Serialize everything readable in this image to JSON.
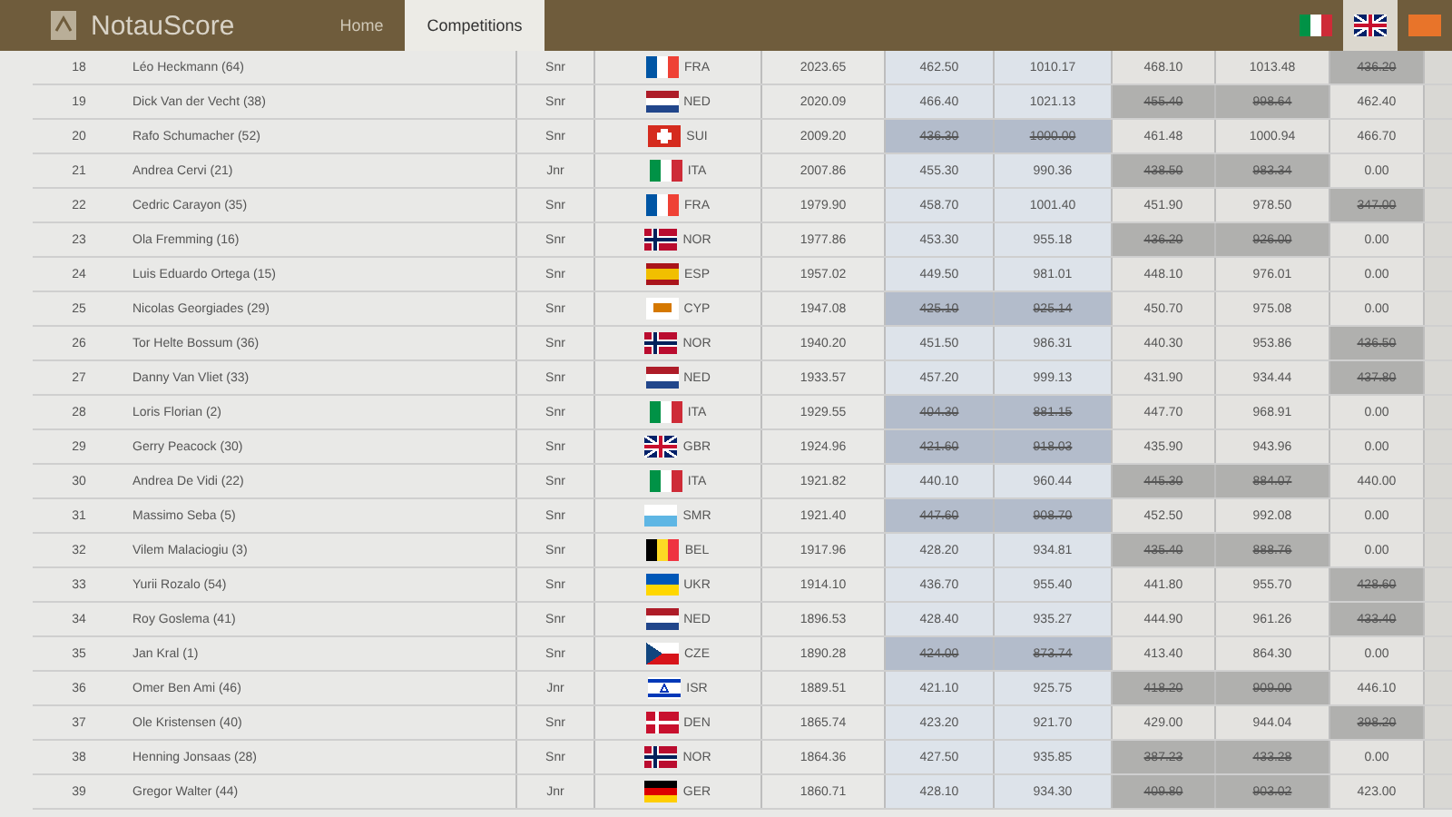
{
  "navbar": {
    "brand": "NotauScore",
    "tabs": [
      {
        "label": "Home",
        "selected": false
      },
      {
        "label": "Competitions",
        "selected": true
      }
    ],
    "languages": [
      {
        "flag": {
          "kind": "v3",
          "stripes": [
            {
              "color": "#009246"
            },
            {
              "color": "#ffffff"
            },
            {
              "color": "#ce2b37"
            }
          ]
        },
        "selected": false
      },
      {
        "flag": {
          "kind": "union",
          "stripes": [
            {
              "color": "#012169"
            },
            {
              "color": "#ffffff"
            },
            {
              "color": "#c8102e"
            }
          ]
        },
        "selected": true
      },
      {
        "flag": {
          "kind": "v3",
          "stripes": [
            {
              "color": "#e8742a"
            },
            {
              "color": "#e8742a"
            },
            {
              "color": "#e8742a"
            }
          ]
        },
        "selected": false
      }
    ]
  },
  "rows": [
    {
      "rank": "18",
      "name": "Léo Heckmann (64)",
      "category": "Snr",
      "nation": "FRA",
      "flag": {
        "kind": "v3",
        "stripes": [
          {
            "color": "#0055a4"
          },
          {
            "color": "#ffffff"
          },
          {
            "color": "#ef4135"
          }
        ]
      },
      "total": "2023.65",
      "scores": [
        {
          "value": "462.50",
          "dropped": false
        },
        {
          "value": "1010.17",
          "dropped": false
        },
        {
          "value": "468.10",
          "dropped": false
        },
        {
          "value": "1013.48",
          "dropped": false
        },
        {
          "value": "436.20",
          "dropped": true
        }
      ]
    },
    {
      "rank": "19",
      "name": "Dick Van der Vecht (38)",
      "category": "Snr",
      "nation": "NED",
      "flag": {
        "kind": "h3",
        "stripes": [
          {
            "color": "#ae1c28"
          },
          {
            "color": "#ffffff"
          },
          {
            "color": "#21468b"
          }
        ]
      },
      "total": "2020.09",
      "scores": [
        {
          "value": "466.40",
          "dropped": false
        },
        {
          "value": "1021.13",
          "dropped": false
        },
        {
          "value": "455.40",
          "dropped": true
        },
        {
          "value": "998.64",
          "dropped": true
        },
        {
          "value": "462.40",
          "dropped": false
        }
      ]
    },
    {
      "rank": "20",
      "name": "Rafo Schumacher (52)",
      "category": "Snr",
      "nation": "SUI",
      "flag": {
        "kind": "swiss",
        "stripes": [
          {
            "color": "#d52b1e"
          },
          {
            "color": "#ffffff"
          }
        ]
      },
      "total": "2009.20",
      "scores": [
        {
          "value": "436.30",
          "dropped": true
        },
        {
          "value": "1000.00",
          "dropped": true
        },
        {
          "value": "461.48",
          "dropped": false
        },
        {
          "value": "1000.94",
          "dropped": false
        },
        {
          "value": "466.70",
          "dropped": false
        }
      ]
    },
    {
      "rank": "21",
      "name": "Andrea Cervi (21)",
      "category": "Jnr",
      "nation": "ITA",
      "flag": {
        "kind": "v3",
        "stripes": [
          {
            "color": "#009246"
          },
          {
            "color": "#ffffff"
          },
          {
            "color": "#ce2b37"
          }
        ]
      },
      "total": "2007.86",
      "scores": [
        {
          "value": "455.30",
          "dropped": false
        },
        {
          "value": "990.36",
          "dropped": false
        },
        {
          "value": "438.50",
          "dropped": true
        },
        {
          "value": "983.34",
          "dropped": true
        },
        {
          "value": "0.00",
          "dropped": false
        }
      ]
    },
    {
      "rank": "22",
      "name": "Cedric Carayon (35)",
      "category": "Snr",
      "nation": "FRA",
      "flag": {
        "kind": "v3",
        "stripes": [
          {
            "color": "#0055a4"
          },
          {
            "color": "#ffffff"
          },
          {
            "color": "#ef4135"
          }
        ]
      },
      "total": "1979.90",
      "scores": [
        {
          "value": "458.70",
          "dropped": false
        },
        {
          "value": "1001.40",
          "dropped": false
        },
        {
          "value": "451.90",
          "dropped": false
        },
        {
          "value": "978.50",
          "dropped": false
        },
        {
          "value": "347.00",
          "dropped": true
        }
      ]
    },
    {
      "rank": "23",
      "name": "Ola Fremming (16)",
      "category": "Snr",
      "nation": "NOR",
      "flag": {
        "kind": "nordic2",
        "stripes": [
          {
            "color": "#ba0c2f"
          },
          {
            "color": "#ffffff"
          },
          {
            "color": "#00205b"
          }
        ]
      },
      "total": "1977.86",
      "scores": [
        {
          "value": "453.30",
          "dropped": false
        },
        {
          "value": "955.18",
          "dropped": false
        },
        {
          "value": "436.20",
          "dropped": true
        },
        {
          "value": "926.00",
          "dropped": true
        },
        {
          "value": "0.00",
          "dropped": false
        }
      ]
    },
    {
      "rank": "24",
      "name": "Luis Eduardo Ortega (15)",
      "category": "Snr",
      "nation": "ESP",
      "flag": {
        "kind": "spain",
        "stripes": [
          {
            "color": "#aa151b"
          },
          {
            "color": "#f1bf00"
          }
        ]
      },
      "total": "1957.02",
      "scores": [
        {
          "value": "449.50",
          "dropped": false
        },
        {
          "value": "981.01",
          "dropped": false
        },
        {
          "value": "448.10",
          "dropped": false
        },
        {
          "value": "976.01",
          "dropped": false
        },
        {
          "value": "0.00",
          "dropped": false
        }
      ]
    },
    {
      "rank": "25",
      "name": "Nicolas Georgiades (29)",
      "category": "Snr",
      "nation": "CYP",
      "flag": {
        "kind": "cyprus",
        "stripes": [
          {
            "color": "#ffffff"
          },
          {
            "color": "#d57800"
          }
        ]
      },
      "total": "1947.08",
      "scores": [
        {
          "value": "425.10",
          "dropped": true
        },
        {
          "value": "925.14",
          "dropped": true
        },
        {
          "value": "450.70",
          "dropped": false
        },
        {
          "value": "975.08",
          "dropped": false
        },
        {
          "value": "0.00",
          "dropped": false
        }
      ]
    },
    {
      "rank": "26",
      "name": "Tor Helte Bossum (36)",
      "category": "Snr",
      "nation": "NOR",
      "flag": {
        "kind": "nordic2",
        "stripes": [
          {
            "color": "#ba0c2f"
          },
          {
            "color": "#ffffff"
          },
          {
            "color": "#00205b"
          }
        ]
      },
      "total": "1940.20",
      "scores": [
        {
          "value": "451.50",
          "dropped": false
        },
        {
          "value": "986.31",
          "dropped": false
        },
        {
          "value": "440.30",
          "dropped": false
        },
        {
          "value": "953.86",
          "dropped": false
        },
        {
          "value": "436.50",
          "dropped": true
        }
      ]
    },
    {
      "rank": "27",
      "name": "Danny Van Vliet (33)",
      "category": "Snr",
      "nation": "NED",
      "flag": {
        "kind": "h3",
        "stripes": [
          {
            "color": "#ae1c28"
          },
          {
            "color": "#ffffff"
          },
          {
            "color": "#21468b"
          }
        ]
      },
      "total": "1933.57",
      "scores": [
        {
          "value": "457.20",
          "dropped": false
        },
        {
          "value": "999.13",
          "dropped": false
        },
        {
          "value": "431.90",
          "dropped": false
        },
        {
          "value": "934.44",
          "dropped": false
        },
        {
          "value": "437.80",
          "dropped": true
        }
      ]
    },
    {
      "rank": "28",
      "name": "Loris Florian (2)",
      "category": "Snr",
      "nation": "ITA",
      "flag": {
        "kind": "v3",
        "stripes": [
          {
            "color": "#009246"
          },
          {
            "color": "#ffffff"
          },
          {
            "color": "#ce2b37"
          }
        ]
      },
      "total": "1929.55",
      "scores": [
        {
          "value": "404.30",
          "dropped": true
        },
        {
          "value": "881.15",
          "dropped": true
        },
        {
          "value": "447.70",
          "dropped": false
        },
        {
          "value": "968.91",
          "dropped": false
        },
        {
          "value": "0.00",
          "dropped": false
        }
      ]
    },
    {
      "rank": "29",
      "name": "Gerry Peacock (30)",
      "category": "Snr",
      "nation": "GBR",
      "flag": {
        "kind": "union",
        "stripes": [
          {
            "color": "#012169"
          },
          {
            "color": "#ffffff"
          },
          {
            "color": "#c8102e"
          }
        ]
      },
      "total": "1924.96",
      "scores": [
        {
          "value": "421.60",
          "dropped": true
        },
        {
          "value": "918.03",
          "dropped": true
        },
        {
          "value": "435.90",
          "dropped": false
        },
        {
          "value": "943.96",
          "dropped": false
        },
        {
          "value": "0.00",
          "dropped": false
        }
      ]
    },
    {
      "rank": "30",
      "name": "Andrea De Vidi (22)",
      "category": "Snr",
      "nation": "ITA",
      "flag": {
        "kind": "v3",
        "stripes": [
          {
            "color": "#009246"
          },
          {
            "color": "#ffffff"
          },
          {
            "color": "#ce2b37"
          }
        ]
      },
      "total": "1921.82",
      "scores": [
        {
          "value": "440.10",
          "dropped": false
        },
        {
          "value": "960.44",
          "dropped": false
        },
        {
          "value": "445.30",
          "dropped": true
        },
        {
          "value": "884.07",
          "dropped": true
        },
        {
          "value": "440.00",
          "dropped": false
        }
      ]
    },
    {
      "rank": "31",
      "name": "Massimo Seba (5)",
      "category": "Snr",
      "nation": "SMR",
      "flag": {
        "kind": "h2",
        "stripes": [
          {
            "color": "#ffffff"
          },
          {
            "color": "#5eb6e4"
          }
        ]
      },
      "total": "1921.40",
      "scores": [
        {
          "value": "447.60",
          "dropped": true
        },
        {
          "value": "908.70",
          "dropped": true
        },
        {
          "value": "452.50",
          "dropped": false
        },
        {
          "value": "992.08",
          "dropped": false
        },
        {
          "value": "0.00",
          "dropped": false
        }
      ]
    },
    {
      "rank": "32",
      "name": "Vilem Malaciogiu (3)",
      "category": "Snr",
      "nation": "BEL",
      "flag": {
        "kind": "v3",
        "stripes": [
          {
            "color": "#000000"
          },
          {
            "color": "#fdda24"
          },
          {
            "color": "#ef3340"
          }
        ]
      },
      "total": "1917.96",
      "scores": [
        {
          "value": "428.20",
          "dropped": false
        },
        {
          "value": "934.81",
          "dropped": false
        },
        {
          "value": "435.40",
          "dropped": true
        },
        {
          "value": "888.76",
          "dropped": true
        },
        {
          "value": "0.00",
          "dropped": false
        }
      ]
    },
    {
      "rank": "33",
      "name": "Yurii Rozalo (54)",
      "category": "Snr",
      "nation": "UKR",
      "flag": {
        "kind": "h2",
        "stripes": [
          {
            "color": "#0057b7"
          },
          {
            "color": "#ffd700"
          }
        ]
      },
      "total": "1914.10",
      "scores": [
        {
          "value": "436.70",
          "dropped": false
        },
        {
          "value": "955.40",
          "dropped": false
        },
        {
          "value": "441.80",
          "dropped": false
        },
        {
          "value": "955.70",
          "dropped": false
        },
        {
          "value": "428.60",
          "dropped": true
        }
      ]
    },
    {
      "rank": "34",
      "name": "Roy Goslema (41)",
      "category": "Snr",
      "nation": "NED",
      "flag": {
        "kind": "h3",
        "stripes": [
          {
            "color": "#ae1c28"
          },
          {
            "color": "#ffffff"
          },
          {
            "color": "#21468b"
          }
        ]
      },
      "total": "1896.53",
      "scores": [
        {
          "value": "428.40",
          "dropped": false
        },
        {
          "value": "935.27",
          "dropped": false
        },
        {
          "value": "444.90",
          "dropped": false
        },
        {
          "value": "961.26",
          "dropped": false
        },
        {
          "value": "433.40",
          "dropped": true
        }
      ]
    },
    {
      "rank": "35",
      "name": "Jan Kral (1)",
      "category": "Snr",
      "nation": "CZE",
      "flag": {
        "kind": "czech",
        "stripes": [
          {
            "color": "#ffffff"
          },
          {
            "color": "#d7141a"
          },
          {
            "color": "#11457e"
          }
        ]
      },
      "total": "1890.28",
      "scores": [
        {
          "value": "424.00",
          "dropped": true
        },
        {
          "value": "873.74",
          "dropped": true
        },
        {
          "value": "413.40",
          "dropped": false
        },
        {
          "value": "864.30",
          "dropped": false
        },
        {
          "value": "0.00",
          "dropped": false
        }
      ]
    },
    {
      "rank": "36",
      "name": "Omer Ben Ami (46)",
      "category": "Jnr",
      "nation": "ISR",
      "flag": {
        "kind": "israel",
        "stripes": [
          {
            "color": "#ffffff"
          },
          {
            "color": "#0038b8"
          }
        ]
      },
      "total": "1889.51",
      "scores": [
        {
          "value": "421.10",
          "dropped": false
        },
        {
          "value": "925.75",
          "dropped": false
        },
        {
          "value": "418.20",
          "dropped": true
        },
        {
          "value": "909.00",
          "dropped": true
        },
        {
          "value": "446.10",
          "dropped": false
        }
      ]
    },
    {
      "rank": "37",
      "name": "Ole Kristensen (40)",
      "category": "Snr",
      "nation": "DEN",
      "flag": {
        "kind": "nordic",
        "stripes": [
          {
            "color": "#c8102e"
          },
          {
            "color": "#ffffff"
          }
        ]
      },
      "total": "1865.74",
      "scores": [
        {
          "value": "423.20",
          "dropped": false
        },
        {
          "value": "921.70",
          "dropped": false
        },
        {
          "value": "429.00",
          "dropped": false
        },
        {
          "value": "944.04",
          "dropped": false
        },
        {
          "value": "398.20",
          "dropped": true
        }
      ]
    },
    {
      "rank": "38",
      "name": "Henning Jonsaas (28)",
      "category": "Snr",
      "nation": "NOR",
      "flag": {
        "kind": "nordic2",
        "stripes": [
          {
            "color": "#ba0c2f"
          },
          {
            "color": "#ffffff"
          },
          {
            "color": "#00205b"
          }
        ]
      },
      "total": "1864.36",
      "scores": [
        {
          "value": "427.50",
          "dropped": false
        },
        {
          "value": "935.85",
          "dropped": false
        },
        {
          "value": "387.23",
          "dropped": true
        },
        {
          "value": "433.28",
          "dropped": true
        },
        {
          "value": "0.00",
          "dropped": false
        }
      ]
    },
    {
      "rank": "39",
      "name": "Gregor Walter (44)",
      "category": "Jnr",
      "nation": "GER",
      "flag": {
        "kind": "h3",
        "stripes": [
          {
            "color": "#000000"
          },
          {
            "color": "#dd0000"
          },
          {
            "color": "#ffce00"
          }
        ]
      },
      "total": "1860.71",
      "scores": [
        {
          "value": "428.10",
          "dropped": false
        },
        {
          "value": "934.30",
          "dropped": false
        },
        {
          "value": "409.80",
          "dropped": true
        },
        {
          "value": "903.02",
          "dropped": true
        },
        {
          "value": "423.00",
          "dropped": false
        }
      ]
    }
  ]
}
